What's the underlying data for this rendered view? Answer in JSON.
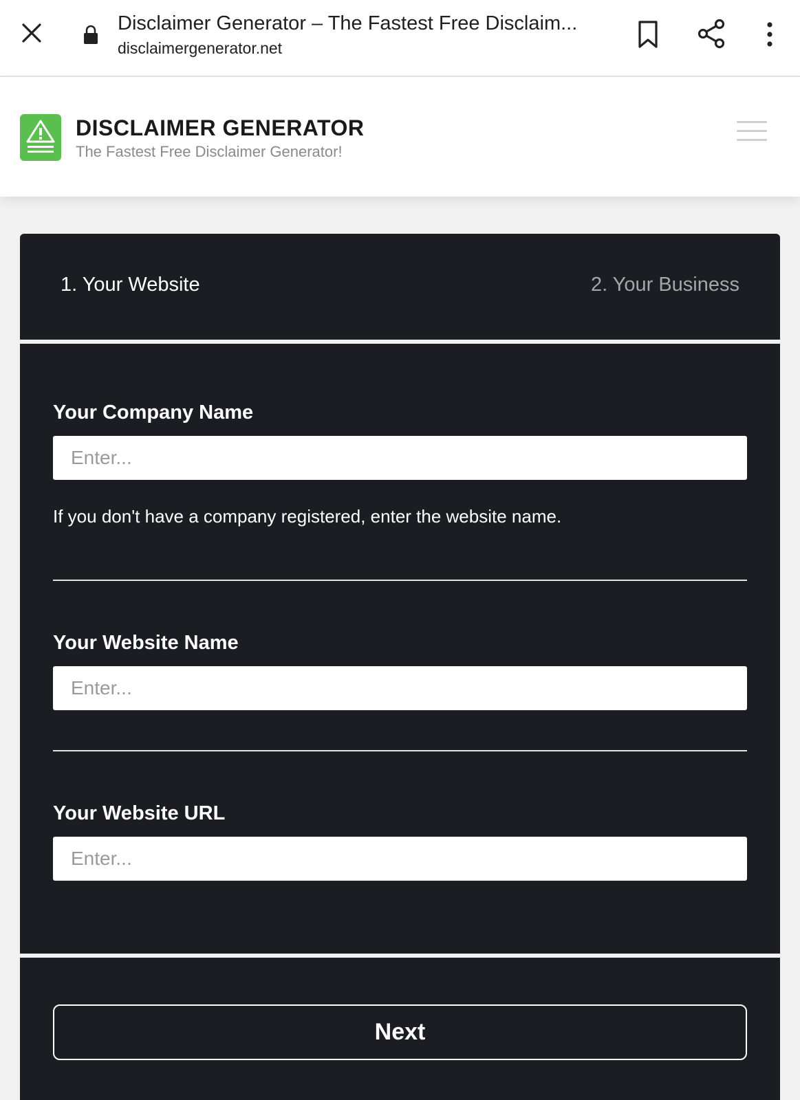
{
  "browser": {
    "page_title": "Disclaimer Generator – The Fastest Free Disclaim...",
    "url": "disclaimergenerator.net"
  },
  "site": {
    "brand_name": "DISCLAIMER GENERATOR",
    "tagline": "The Fastest Free Disclaimer Generator!",
    "brand_color": "#5bbf4f"
  },
  "steps": [
    {
      "label": "1. Your Website",
      "active": true
    },
    {
      "label": "2. Your Business",
      "active": false
    }
  ],
  "form": {
    "company_name": {
      "label": "Your Company Name",
      "placeholder": "Enter...",
      "value": "",
      "help": "If you don't have a company registered, enter the website name."
    },
    "website_name": {
      "label": "Your Website Name",
      "placeholder": "Enter...",
      "value": ""
    },
    "website_url": {
      "label": "Your Website URL",
      "placeholder": "Enter...",
      "value": ""
    },
    "next_label": "Next"
  },
  "colors": {
    "card_bg": "#1c1d23",
    "inactive_step": "#a6a6aa"
  }
}
